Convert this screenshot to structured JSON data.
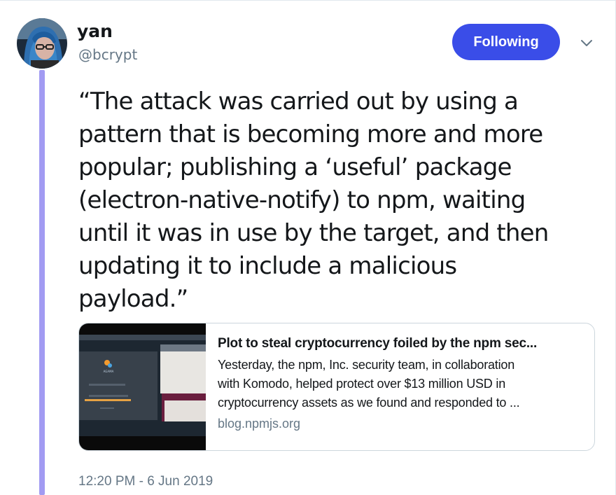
{
  "user": {
    "display_name": "yan",
    "handle": "@bcrypt"
  },
  "follow_button": {
    "label": "Following",
    "color": "#3a4de8"
  },
  "menu": {
    "icon": "chevron-down-icon"
  },
  "tweet": {
    "lines": [
      "“The attack was carried out by using a",
      "pattern that is becoming more and more",
      "popular; publishing a ‘useful’ package",
      "(electron-native-notify) to npm, waiting",
      "until it was in use by the target, and then",
      "updating it to include a malicious",
      "payload.”"
    ],
    "timestamp": "12:20 PM - 6 Jun 2019"
  },
  "link_card": {
    "title": "Plot to steal cryptocurrency foiled by the npm sec...",
    "description_lines": [
      "Yesterday, the npm, Inc. security team, in collaboration",
      "with Komodo, helped protect over $13 million USD in",
      "cryptocurrency assets as we found and responded to ..."
    ],
    "domain": "blog.npmjs.org",
    "thumbnail_text": "AGAMA"
  },
  "thread_line_color": "#a29bf2"
}
